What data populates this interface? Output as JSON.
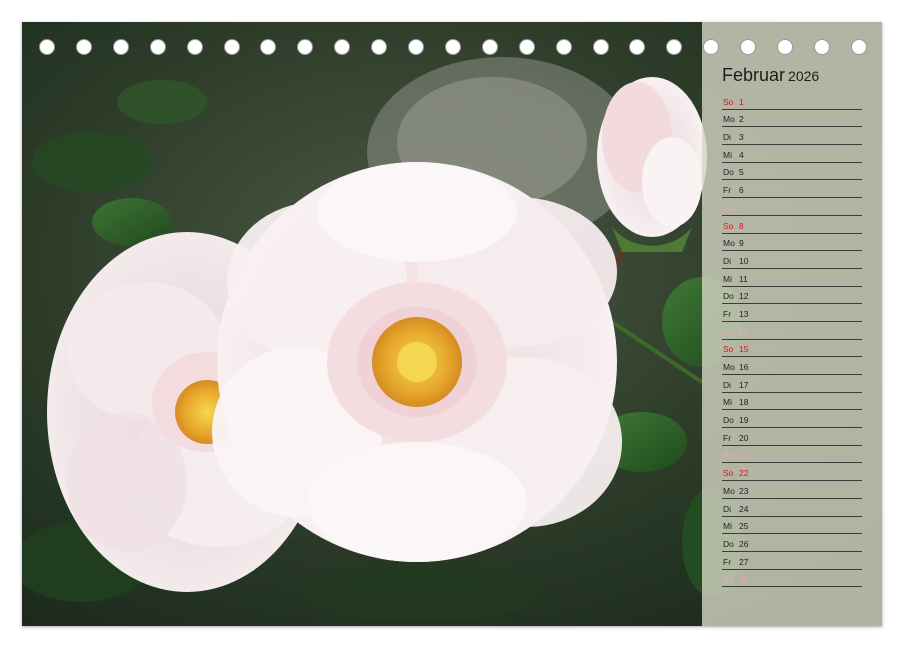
{
  "calendar": {
    "month": "Februar",
    "year": "2026",
    "days": [
      {
        "wd": "So",
        "d": "1",
        "type": "sun"
      },
      {
        "wd": "Mo",
        "d": "2",
        "type": "reg"
      },
      {
        "wd": "Di",
        "d": "3",
        "type": "reg"
      },
      {
        "wd": "Mi",
        "d": "4",
        "type": "reg"
      },
      {
        "wd": "Do",
        "d": "5",
        "type": "reg"
      },
      {
        "wd": "Fr",
        "d": "6",
        "type": "reg"
      },
      {
        "wd": "Sa",
        "d": "7",
        "type": "sat"
      },
      {
        "wd": "So",
        "d": "8",
        "type": "sun"
      },
      {
        "wd": "Mo",
        "d": "9",
        "type": "reg"
      },
      {
        "wd": "Di",
        "d": "10",
        "type": "reg"
      },
      {
        "wd": "Mi",
        "d": "11",
        "type": "reg"
      },
      {
        "wd": "Do",
        "d": "12",
        "type": "reg"
      },
      {
        "wd": "Fr",
        "d": "13",
        "type": "reg"
      },
      {
        "wd": "Sa",
        "d": "14",
        "type": "sat"
      },
      {
        "wd": "So",
        "d": "15",
        "type": "sun"
      },
      {
        "wd": "Mo",
        "d": "16",
        "type": "reg"
      },
      {
        "wd": "Di",
        "d": "17",
        "type": "reg"
      },
      {
        "wd": "Mi",
        "d": "18",
        "type": "reg"
      },
      {
        "wd": "Do",
        "d": "19",
        "type": "reg"
      },
      {
        "wd": "Fr",
        "d": "20",
        "type": "reg"
      },
      {
        "wd": "Sa",
        "d": "21",
        "type": "sat"
      },
      {
        "wd": "So",
        "d": "22",
        "type": "sun"
      },
      {
        "wd": "Mo",
        "d": "23",
        "type": "reg"
      },
      {
        "wd": "Di",
        "d": "24",
        "type": "reg"
      },
      {
        "wd": "Mi",
        "d": "25",
        "type": "reg"
      },
      {
        "wd": "Do",
        "d": "26",
        "type": "reg"
      },
      {
        "wd": "Fr",
        "d": "27",
        "type": "reg"
      },
      {
        "wd": "Sa",
        "d": "28",
        "type": "sat"
      }
    ]
  },
  "colors": {
    "sunday": "#e0121f",
    "saturday": "#e3a9b6",
    "weekday": "#1f1f1f",
    "panel": "#d6d4c4"
  },
  "photo": {
    "subject": "pale pink roses"
  },
  "binding": {
    "hole_count": 23
  }
}
